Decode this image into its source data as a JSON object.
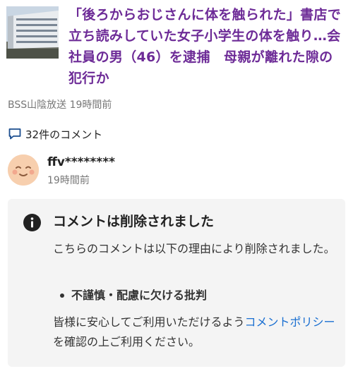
{
  "article": {
    "headline": "「後ろからおじさんに体を触られた」書店で立ち読みしていた女子小学生の体を触り…会社員の男（46）を逮捕　母親が離れた隙の犯行か",
    "source": "BSS山陰放送 19時間前"
  },
  "comments": {
    "count_label": "32件のコメント",
    "icon": "speech-bubble-icon"
  },
  "comment": {
    "username": "ffv********",
    "time": "19時間前",
    "avatar_icon": "smiley-face-icon"
  },
  "notice": {
    "icon": "info-icon",
    "title": "コメントは削除されました",
    "body": "こちらのコメントは以下の理由により削除されました。",
    "reason": "不謹慎・配慮に欠ける批判",
    "footer_before": "皆様に安心してご利用いただけるよう",
    "footer_link": "コメントポリシー",
    "footer_after": "を確認の上ご利用ください。"
  },
  "colors": {
    "headline": "#6d2b97",
    "link": "#1a6fd1",
    "notice_bg": "#f4f4f4",
    "avatar": "#f7cfae"
  }
}
